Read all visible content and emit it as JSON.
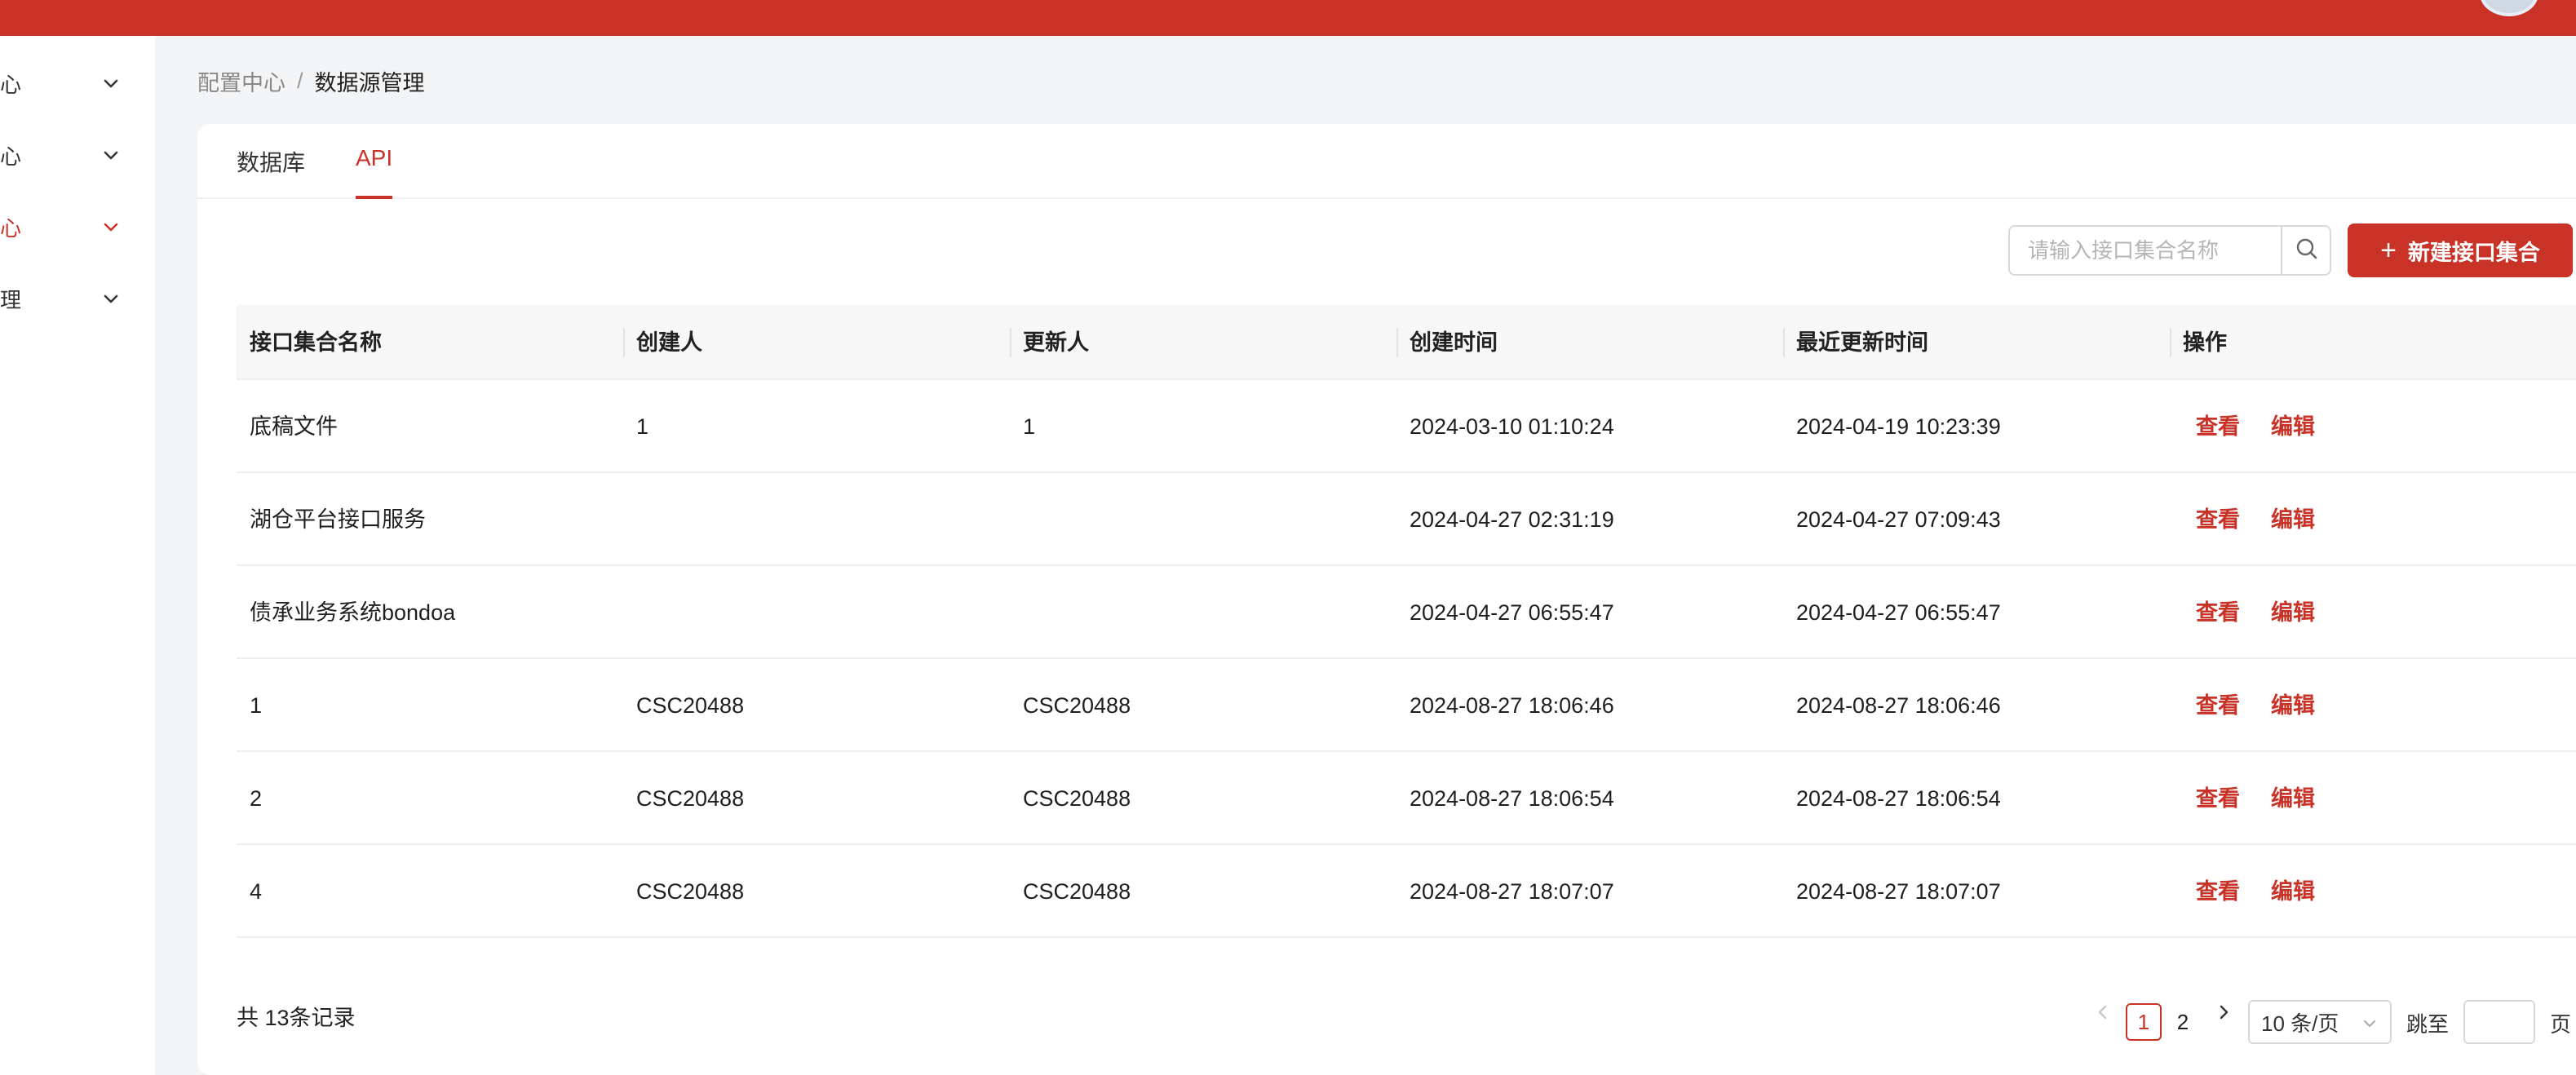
{
  "colors": {
    "accent": "#c93227",
    "header": "#c93227",
    "background": "#f3f4f6"
  },
  "sidebar": {
    "items": [
      {
        "label": "心",
        "active": false,
        "icon": "chevron-down-icon"
      },
      {
        "label": "心",
        "active": false,
        "icon": "chevron-down-icon"
      },
      {
        "label": "心",
        "active": true,
        "icon": "chevron-down-icon"
      },
      {
        "label": "理",
        "active": false,
        "icon": "chevron-down-icon"
      }
    ]
  },
  "breadcrumb": {
    "parent": "配置中心",
    "separator": "/",
    "current": "数据源管理"
  },
  "tabs": [
    {
      "label": "数据库",
      "active": false
    },
    {
      "label": "API",
      "active": true
    }
  ],
  "toolbar": {
    "search_placeholder": "请输入接口集合名称",
    "search_icon": "search-icon",
    "new_button_label": "新建接口集合",
    "new_button_icon": "plus-icon"
  },
  "table": {
    "columns": [
      "接口集合名称",
      "创建人",
      "更新人",
      "创建时间",
      "最近更新时间",
      "操作"
    ],
    "rows": [
      {
        "name": "底稿文件",
        "creator": "1",
        "updater": "1",
        "created": "2024-03-10 01:10:24",
        "updated": "2024-04-19 10:23:39"
      },
      {
        "name": "湖仓平台接口服务",
        "creator": "",
        "updater": "",
        "created": "2024-04-27 02:31:19",
        "updated": "2024-04-27 07:09:43"
      },
      {
        "name": "债承业务系统bondoa",
        "creator": "",
        "updater": "",
        "created": "2024-04-27 06:55:47",
        "updated": "2024-04-27 06:55:47"
      },
      {
        "name": "1",
        "creator": "CSC20488",
        "updater": "CSC20488",
        "created": "2024-08-27 18:06:46",
        "updated": "2024-08-27 18:06:46"
      },
      {
        "name": "2",
        "creator": "CSC20488",
        "updater": "CSC20488",
        "created": "2024-08-27 18:06:54",
        "updated": "2024-08-27 18:06:54"
      },
      {
        "name": "4",
        "creator": "CSC20488",
        "updater": "CSC20488",
        "created": "2024-08-27 18:07:07",
        "updated": "2024-08-27 18:07:07"
      }
    ],
    "actions": {
      "view": "查看",
      "edit": "编辑"
    }
  },
  "pagination": {
    "total_text": "共 13条记录",
    "pages": [
      "1",
      "2"
    ],
    "current_page": "1",
    "page_size": "10 条/页",
    "jump_label": "跳至",
    "page_suffix": "页"
  }
}
